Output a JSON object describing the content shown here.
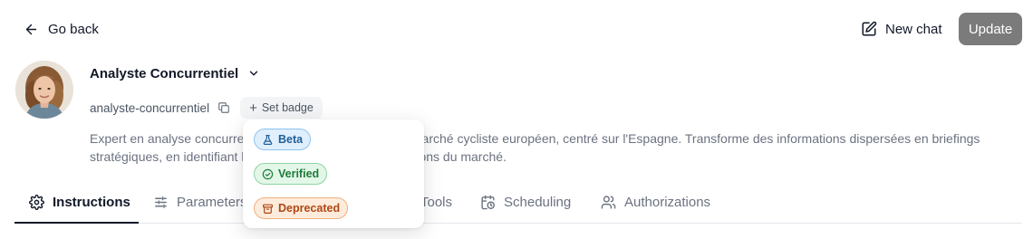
{
  "header": {
    "back_label": "Go back",
    "new_chat_label": "New chat",
    "update_label": "Update"
  },
  "agent": {
    "name": "Analyste Concurrentiel",
    "handle": "analyste-concurrentiel",
    "set_badge_label": "Set badge",
    "description_line1": "Expert en analyse concurrentielle et veille stratégique du marché cycliste européen, centré sur l'Espagne. Transforme des informations dispersées en briefings",
    "description_line2": "stratégiques, en identifiant les signaux faibles et les évolutions du marché."
  },
  "tabs": [
    {
      "label": "Instructions",
      "icon": "gear-icon",
      "active": true
    },
    {
      "label": "Parameters",
      "icon": "sliders-icon",
      "active": false
    },
    {
      "label": "Tools",
      "icon": "tools-icon",
      "active": false
    },
    {
      "label": "Scheduling",
      "icon": "calendar-clock-icon",
      "active": false
    },
    {
      "label": "Authorizations",
      "icon": "users-icon",
      "active": false
    }
  ],
  "badge_menu": {
    "options": [
      {
        "label": "Beta",
        "icon": "flask-icon",
        "color": "#1f5f99"
      },
      {
        "label": "Verified",
        "icon": "check-circle-icon",
        "color": "#1f7a3a"
      },
      {
        "label": "Deprecated",
        "icon": "archive-icon",
        "color": "#b04714"
      }
    ]
  }
}
